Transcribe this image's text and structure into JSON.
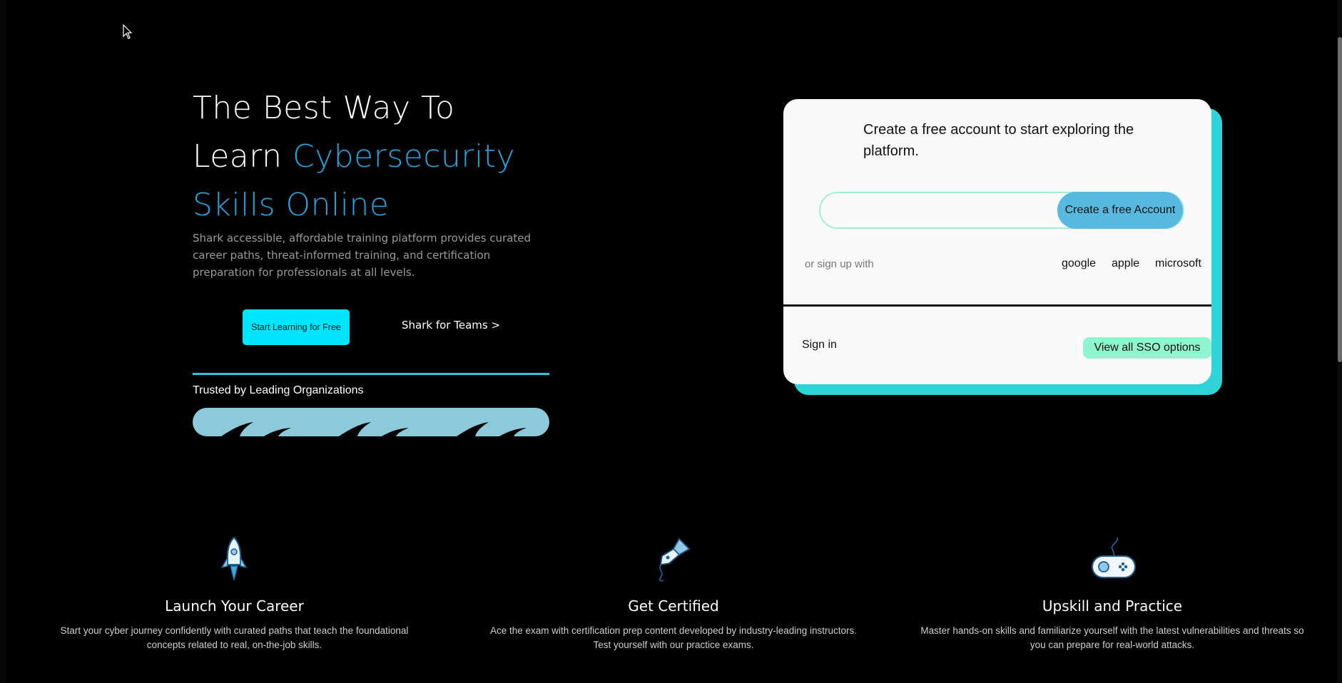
{
  "hero": {
    "title_line1": "The Best Way To",
    "title_learn": "Learn",
    "title_accent1": "Cybersecurity",
    "title_accent2": "Skills Online",
    "description": "Shark accessible, affordable training platform provides curated career paths, threat-informed training, and certification preparation for professionals at all levels.",
    "start_button": "Start Learning for Free",
    "teams_link": "Shark for Teams >",
    "trusted_label": "Trusted by Leading Organizations"
  },
  "signup_card": {
    "intro": "Create a free account to start exploring the platform.",
    "email_value": "",
    "create_button": "Create a free Account",
    "or_signup": "or sign up with",
    "sso_providers": [
      "google",
      "apple",
      "microsoft"
    ],
    "sign_in": "Sign in",
    "view_sso_button": "View all SSO options"
  },
  "features": [
    {
      "icon": "rocket-icon",
      "title": "Launch Your Career",
      "description": "Start your cyber journey confidently with curated paths that teach the foundational concepts related to real, on-the-job skills."
    },
    {
      "icon": "pen-nib-icon",
      "title": "Get Certified",
      "description": "Ace the exam with certification prep content developed by industry-leading instructors. Test yourself with our practice exams."
    },
    {
      "icon": "gamepad-icon",
      "title": "Upskill and Practice",
      "description": "Master hands-on skills and familiarize yourself with the latest vulnerabilities and threats so you can prepare for real-world attacks."
    }
  ],
  "colors": {
    "accent_blue": "#22a3df",
    "start_button": "#00e5ff",
    "create_button": "#58b9e0",
    "sso_button": "#8ef5cf",
    "card_shadow": "#2fd4d9"
  }
}
